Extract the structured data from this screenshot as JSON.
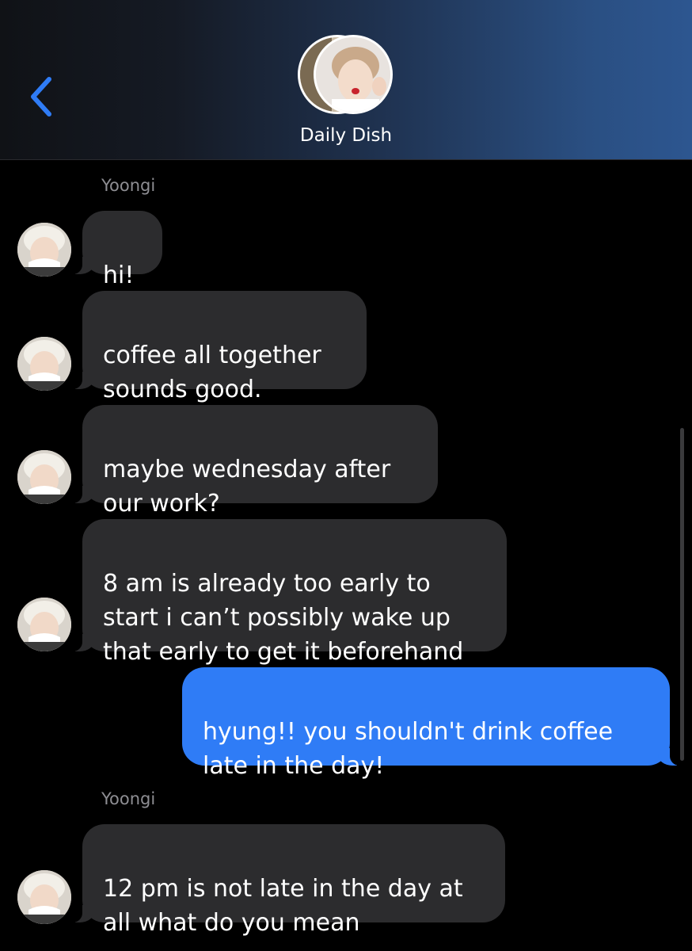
{
  "header": {
    "group_name": "Daily Dish",
    "back_icon": "chevron-left-icon",
    "accent_color": "#2f7cf6"
  },
  "messages": [
    {
      "sender": "Yoongi",
      "direction": "received",
      "show_sender": true,
      "show_avatar": true,
      "text": "hi!"
    },
    {
      "sender": "Yoongi",
      "direction": "received",
      "show_sender": false,
      "show_avatar": true,
      "text": "coffee all together\nsounds good."
    },
    {
      "sender": "Yoongi",
      "direction": "received",
      "show_sender": false,
      "show_avatar": true,
      "text": "maybe wednesday after\nour work?"
    },
    {
      "sender": "Yoongi",
      "direction": "received",
      "show_sender": false,
      "show_avatar": true,
      "text": "8 am is already too early to\nstart i can’t possibly wake up\nthat early to get it beforehand"
    },
    {
      "sender": "",
      "direction": "sent",
      "show_sender": false,
      "show_avatar": false,
      "text": "hyung!! you shouldn't drink coffee\nlate in the day!"
    },
    {
      "sender": "Yoongi",
      "direction": "received",
      "show_sender": true,
      "show_avatar": true,
      "text": "12 pm is not late in the day at\nall what do you mean"
    }
  ],
  "colors": {
    "received_bubble": "#2c2c2e",
    "sent_bubble": "#2f7cf6",
    "sender_label": "#8e8e93"
  }
}
